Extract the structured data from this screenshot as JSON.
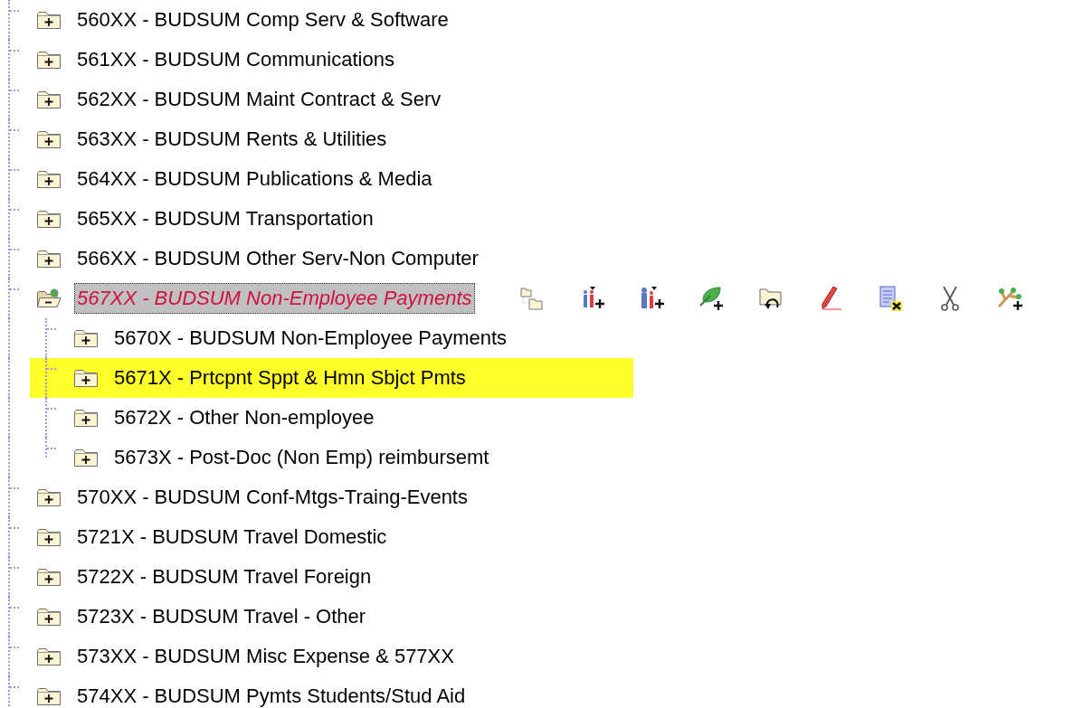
{
  "tree": [
    {
      "label": "560XX - BUDSUM Comp Serv & Software",
      "expanded": false,
      "selected": false,
      "highlighted": false
    },
    {
      "label": "561XX - BUDSUM Communications",
      "expanded": false,
      "selected": false,
      "highlighted": false
    },
    {
      "label": "562XX - BUDSUM Maint Contract & Serv",
      "expanded": false,
      "selected": false,
      "highlighted": false
    },
    {
      "label": "563XX - BUDSUM Rents & Utilities",
      "expanded": false,
      "selected": false,
      "highlighted": false
    },
    {
      "label": "564XX - BUDSUM Publications & Media",
      "expanded": false,
      "selected": false,
      "highlighted": false
    },
    {
      "label": "565XX - BUDSUM Transportation",
      "expanded": false,
      "selected": false,
      "highlighted": false
    },
    {
      "label": "566XX - BUDSUM Other Serv-Non Computer",
      "expanded": false,
      "selected": false,
      "highlighted": false
    },
    {
      "label": "567XX - BUDSUM Non-Employee Payments",
      "expanded": true,
      "selected": true,
      "highlighted": false,
      "children": [
        {
          "label": "5670X - BUDSUM Non-Employee Payments",
          "expanded": false,
          "selected": false,
          "highlighted": false
        },
        {
          "label": "5671X - Prtcpnt Sppt & Hmn Sbjct Pmts",
          "expanded": false,
          "selected": false,
          "highlighted": true
        },
        {
          "label": "5672X - Other Non-employee",
          "expanded": false,
          "selected": false,
          "highlighted": false
        },
        {
          "label": "5673X - Post-Doc (Non Emp) reimbursemt",
          "expanded": false,
          "selected": false,
          "highlighted": false
        }
      ]
    },
    {
      "label": "570XX - BUDSUM Conf-Mtgs-Traing-Events",
      "expanded": false,
      "selected": false,
      "highlighted": false
    },
    {
      "label": "5721X - BUDSUM Travel Domestic",
      "expanded": false,
      "selected": false,
      "highlighted": false
    },
    {
      "label": "5722X - BUDSUM Travel Foreign",
      "expanded": false,
      "selected": false,
      "highlighted": false
    },
    {
      "label": "5723X - BUDSUM Travel - Other",
      "expanded": false,
      "selected": false,
      "highlighted": false
    },
    {
      "label": "573XX - BUDSUM Misc Expense & 577XX",
      "expanded": false,
      "selected": false,
      "highlighted": false
    },
    {
      "label": "574XX - BUDSUM Pymts Students/Stud Aid",
      "expanded": false,
      "selected": false,
      "highlighted": false
    }
  ]
}
